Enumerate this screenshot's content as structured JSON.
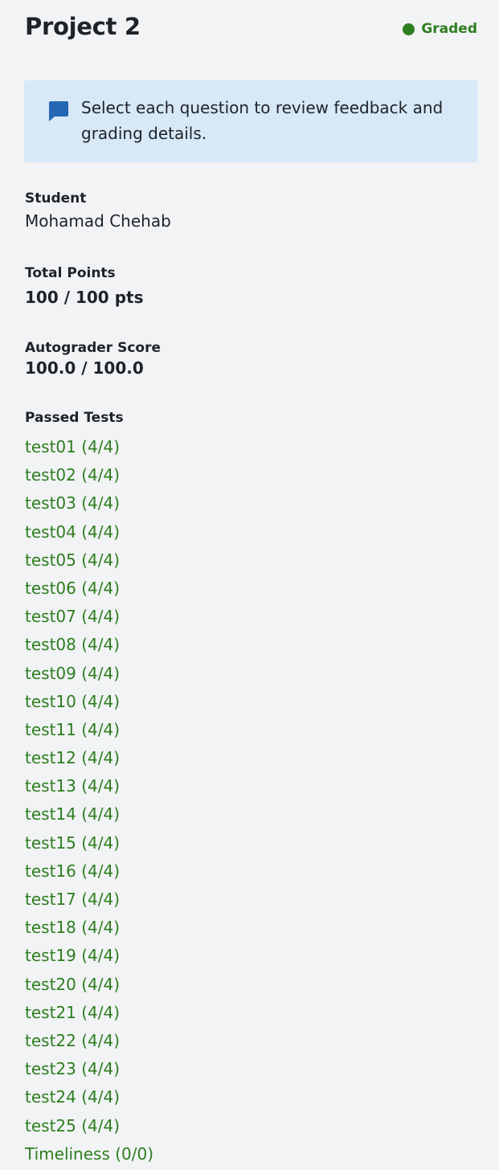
{
  "header": {
    "title": "Project 2",
    "status": "Graded"
  },
  "banner": {
    "message": "Select each question to review feedback and grading details."
  },
  "student": {
    "label": "Student",
    "value": "Mohamad Chehab"
  },
  "total_points": {
    "label": "Total Points",
    "value": "100 / 100 pts"
  },
  "autograder": {
    "label": "Autograder Score",
    "value": "100.0 / 100.0"
  },
  "passed_tests": {
    "label": "Passed Tests",
    "items": [
      "test01 (4/4)",
      "test02 (4/4)",
      "test03 (4/4)",
      "test04 (4/4)",
      "test05 (4/4)",
      "test06 (4/4)",
      "test07 (4/4)",
      "test08 (4/4)",
      "test09 (4/4)",
      "test10 (4/4)",
      "test11 (4/4)",
      "test12 (4/4)",
      "test13 (4/4)",
      "test14 (4/4)",
      "test15 (4/4)",
      "test16 (4/4)",
      "test17 (4/4)",
      "test18 (4/4)",
      "test19 (4/4)",
      "test20 (4/4)",
      "test21 (4/4)",
      "test22 (4/4)",
      "test23 (4/4)",
      "test24 (4/4)",
      "test25 (4/4)",
      "Timeliness (0/0)"
    ]
  },
  "colors": {
    "success": "#2e7d1e",
    "banner_bg": "#d7e8f7",
    "banner_icon": "#2467b3",
    "page_bg": "#f1f3f5"
  },
  "icons": {
    "status": "status-dot-icon",
    "banner": "chat-bubble-icon"
  }
}
